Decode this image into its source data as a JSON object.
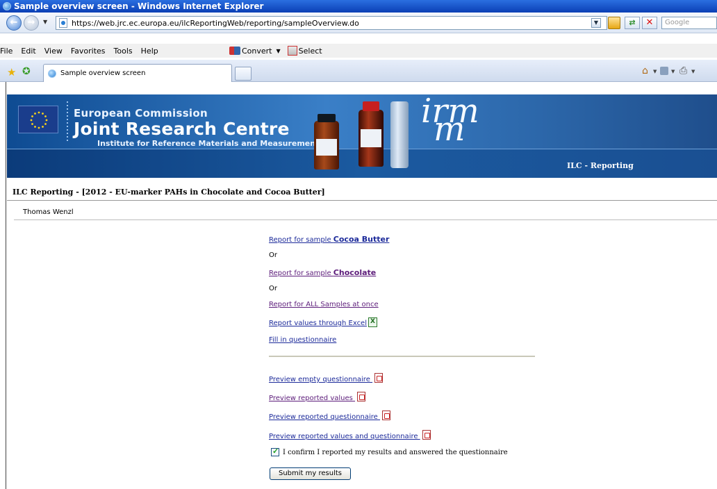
{
  "window": {
    "title": "Sample overview screen - Windows Internet Explorer"
  },
  "address_bar": {
    "url": "https://web.jrc.ec.europa.eu/ilcReportingWeb/reporting/sampleOverview.do",
    "search_placeholder": "Google"
  },
  "menu": {
    "items": [
      "File",
      "Edit",
      "View",
      "Favorites",
      "Tools",
      "Help"
    ],
    "convert_label": "Convert",
    "select_label": "Select"
  },
  "tabs": [
    {
      "label": "Sample overview screen"
    }
  ],
  "banner": {
    "line1": "European Commission",
    "line2": "Joint Research Centre",
    "line3": "Institute for Reference Materials and Measurements",
    "logo_top": "irm",
    "logo_bottom": "m",
    "app_label": "ILC - Reporting"
  },
  "page": {
    "title": "ILC Reporting - [2012 - EU-marker PAHs in Chocolate and Cocoa Butter]",
    "user": "Thomas  Wenzl",
    "links": {
      "cocoa_prefix": "Report for sample ",
      "cocoa_sample": "Cocoa Butter",
      "or1": "Or",
      "choc_prefix": "Report for sample ",
      "choc_sample": "Chocolate",
      "or2": "Or",
      "all_samples": "Report for ALL Samples at once",
      "excel": "Report values through Excel",
      "questionnaire": "Fill in questionnaire",
      "preview_empty": "Preview empty questionnaire ",
      "preview_values": "Preview reported values ",
      "preview_questionnaire": "Preview reported questionnaire ",
      "preview_both": "Preview reported values and questionnaire "
    },
    "confirm_label": "I confirm I reported my results and answered the questionnaire",
    "confirm_checked": true,
    "submit_label": "Submit my results"
  },
  "colors": {
    "link": "#1c2a9a",
    "visited_link": "#5c1c7a",
    "banner": "#1d4d8f"
  }
}
